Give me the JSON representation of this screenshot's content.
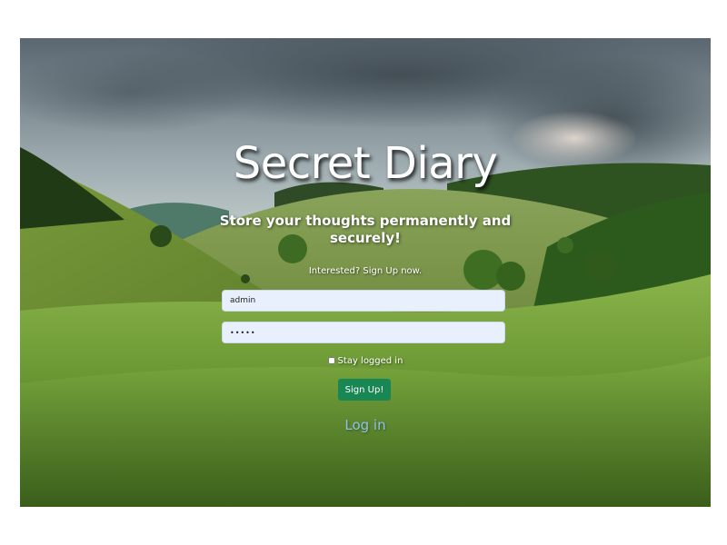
{
  "page": {
    "title": "Secret Diary",
    "subtitle": "Store your thoughts permanently and securely!",
    "prompt": "Interested? Sign Up now."
  },
  "form": {
    "username_value": "admin",
    "password_value": "•••••",
    "stay_logged_in_label": "Stay logged in",
    "stay_logged_in_checked": false,
    "signup_label": "Sign Up!",
    "login_link_label": "Log in"
  },
  "colors": {
    "signup_button": "#198754",
    "login_link": "#8fc1ec",
    "input_fill": "#e8f0fe"
  },
  "icons": {
    "background": "hillside-landscape-image"
  }
}
